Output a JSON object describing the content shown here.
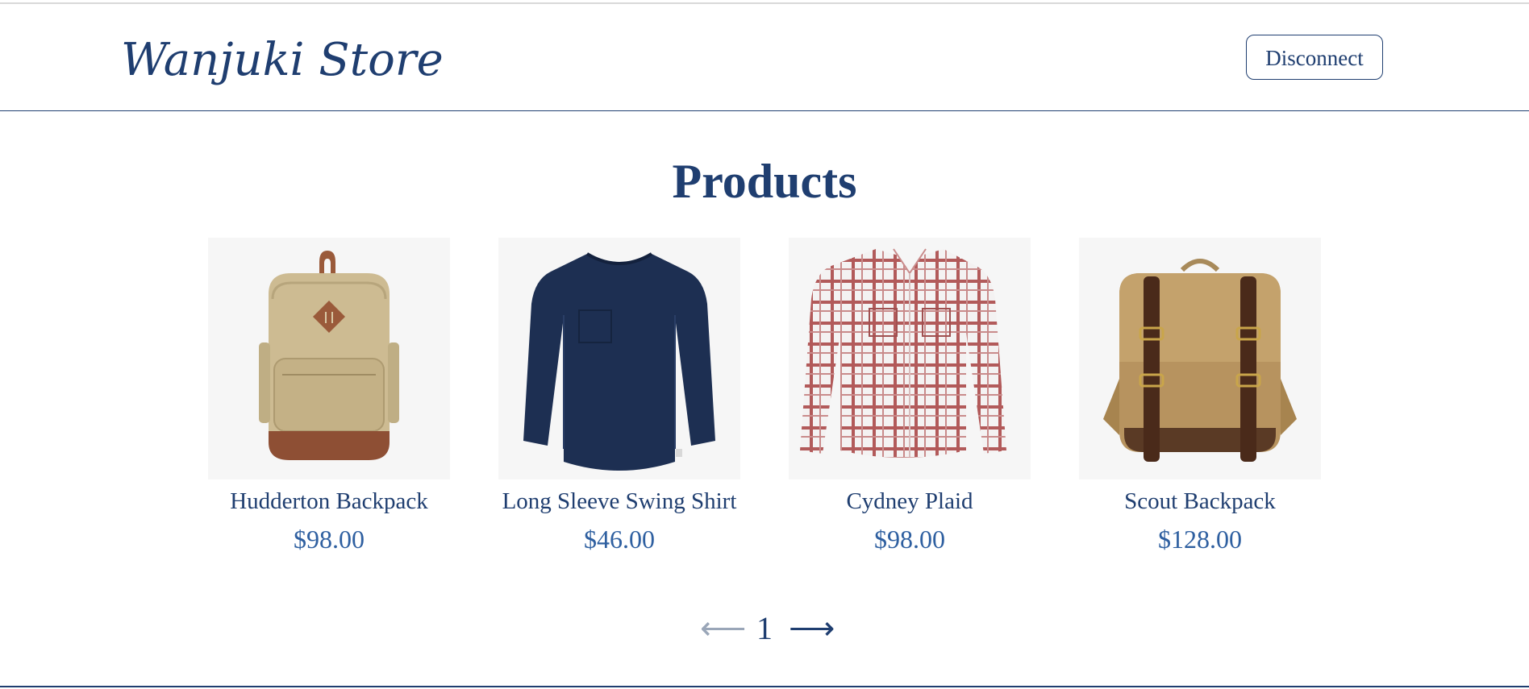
{
  "header": {
    "brand": "Wanjuki Store",
    "disconnect_label": "Disconnect"
  },
  "main": {
    "title": "Products",
    "products": [
      {
        "name": "Hudderton Backpack",
        "price": "$98.00",
        "image": "backpack-tan-icon"
      },
      {
        "name": "Long Sleeve Swing Shirt",
        "price": "$46.00",
        "image": "navy-shirt-icon"
      },
      {
        "name": "Cydney Plaid",
        "price": "$98.00",
        "image": "plaid-shirt-icon"
      },
      {
        "name": "Scout Backpack",
        "price": "$128.00",
        "image": "strapped-backpack-icon"
      }
    ]
  },
  "pagination": {
    "prev": "⟵",
    "page": "1",
    "next": "⟶"
  },
  "colors": {
    "primary": "#1f3e70",
    "price": "#2e5fa0",
    "thumb_bg": "#f6f6f6"
  }
}
